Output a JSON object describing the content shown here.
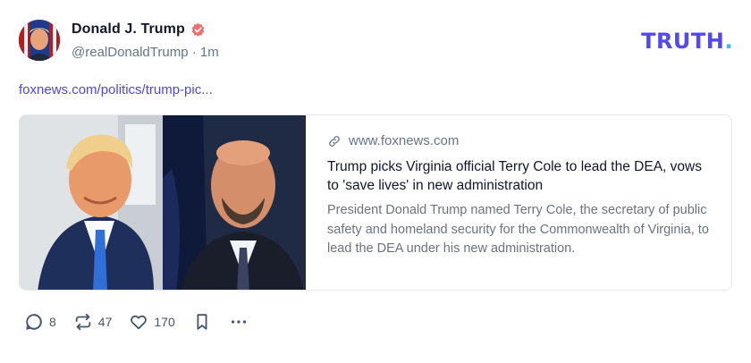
{
  "author": {
    "display_name": "Donald J. Trump",
    "handle": "@realDonaldTrump",
    "separator": "·",
    "time": "1m",
    "verified": true,
    "verified_color": "#ef6f6f"
  },
  "brand": {
    "logo_text": "TRUTH",
    "logo_dot": ".",
    "color": "#5448ee",
    "dot_color": "#38bdf8"
  },
  "post": {
    "link_text": "foxnews.com/politics/trump-pic..."
  },
  "card": {
    "domain": "www.foxnews.com",
    "title": "Trump picks Virginia official Terry Cole to lead the DEA, vows to 'save lives' in new administration",
    "description": "President Donald Trump named Terry Cole, the secretary of public safety and homeland security for the Commonwealth of Virginia, to lead the DEA under his new administration.",
    "image_alt": "Donald Trump and Terry Cole portraits"
  },
  "actions": {
    "reply_count": "8",
    "retruth_count": "47",
    "like_count": "170",
    "icons": [
      "reply-icon",
      "retruth-icon",
      "like-icon",
      "bookmark-icon",
      "more-icon"
    ]
  },
  "colors": {
    "link": "#4f46e5",
    "muted": "#64748b",
    "text": "#0f172a"
  }
}
